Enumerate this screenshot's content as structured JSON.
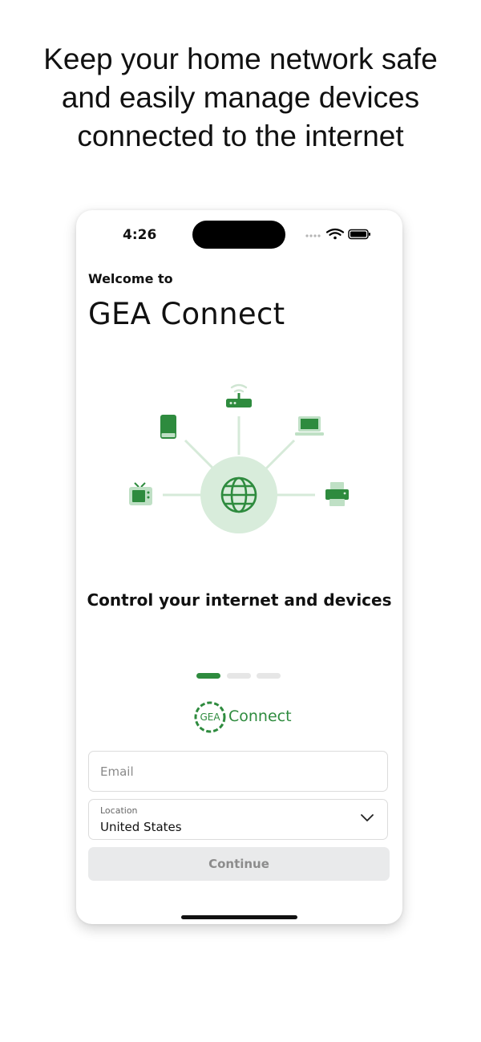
{
  "headline": {
    "line1": "Keep your home network safe",
    "line2": "and easily manage devices",
    "line3": "connected to the internet"
  },
  "status_bar": {
    "time": "4:26"
  },
  "welcome": {
    "subtitle": "Welcome to",
    "title": "GEA Connect"
  },
  "onboarding": {
    "tagline": "Control your internet and devices",
    "page_count": 3,
    "active_page": 1
  },
  "brand": {
    "logo_mark": "GEA",
    "logo_text": "Connect"
  },
  "form": {
    "email_placeholder": "Email",
    "email_value": "",
    "location_label": "Location",
    "location_value": "United States",
    "continue_label": "Continue"
  },
  "colors": {
    "accent": "#2e8b3e",
    "accent_light": "#d8ecdb",
    "button_disabled_bg": "#e9eaeb",
    "button_disabled_text": "#8c8c8c"
  },
  "icons": [
    "router-icon",
    "tablet-icon",
    "laptop-icon",
    "globe-icon",
    "tv-icon",
    "printer-icon",
    "wifi-icon",
    "battery-icon",
    "signal-dots-icon",
    "chevron-down-icon"
  ]
}
